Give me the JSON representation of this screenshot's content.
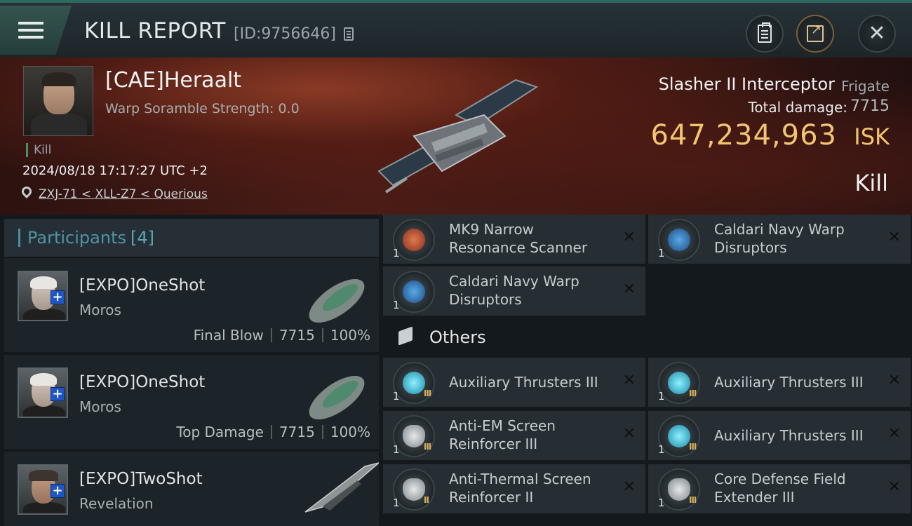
{
  "header": {
    "title": "KILL REPORT",
    "report_id": "[ID:9756646]",
    "icons": [
      "menu-icon",
      "copy-icon",
      "clipboard-icon",
      "share-icon",
      "close-icon"
    ]
  },
  "victim": {
    "name": "[CAE]Heraalt",
    "warp_strength": "Warp Soramble Strength: 0.0",
    "tag": "Kill",
    "time": "2024/08/18 17:17:27 UTC +2",
    "location": "ZXJ-71 < XLL-Z7 < Querious"
  },
  "ship": {
    "name": "Slasher II Interceptor",
    "class": "Frigate",
    "damage_label": "Total damage:",
    "damage_value": "7715",
    "isk_value": "647,234,963",
    "isk_unit": "ISK",
    "result": "Kill"
  },
  "participants": {
    "title": "Participants",
    "count": "[4]",
    "items": [
      {
        "name": "[EXPO]OneShot",
        "ship": "Moros",
        "role": "Final Blow",
        "damage": "7715",
        "percent": "100%"
      },
      {
        "name": "[EXPO]OneShot",
        "ship": "Moros",
        "role": "Top Damage",
        "damage": "7715",
        "percent": "100%"
      },
      {
        "name": "[EXPO]TwoShot",
        "ship": "Revelation"
      }
    ]
  },
  "modules": {
    "top": [
      {
        "name_line1": "MK9 Narrow",
        "name_line2": "Resonance Scanner",
        "qty": "1"
      },
      {
        "name_line1": "Caldari Navy Warp",
        "name_line2": "Disruptors",
        "qty": "1"
      },
      {
        "name_line1": "Caldari Navy Warp",
        "name_line2": "Disruptors",
        "qty": "1"
      }
    ],
    "others_title": "Others",
    "others": [
      {
        "name": "Auxiliary Thrusters III",
        "qty": "1"
      },
      {
        "name": "Auxiliary Thrusters III",
        "qty": "1"
      },
      {
        "name_line1": "Anti-EM Screen",
        "name_line2": "Reinforcer III",
        "qty": "1"
      },
      {
        "name": "Auxiliary Thrusters III",
        "qty": "1"
      },
      {
        "name_line1": "Anti-Thermal Screen",
        "name_line2": "Reinforcer II",
        "qty": "1"
      },
      {
        "name_line1": "Core Defense Field",
        "name_line2": "Extender III",
        "qty": "1"
      }
    ]
  },
  "colors": {
    "accent": "#4f93a3",
    "isk": "#f4c470",
    "badge": "#1e56c8"
  }
}
